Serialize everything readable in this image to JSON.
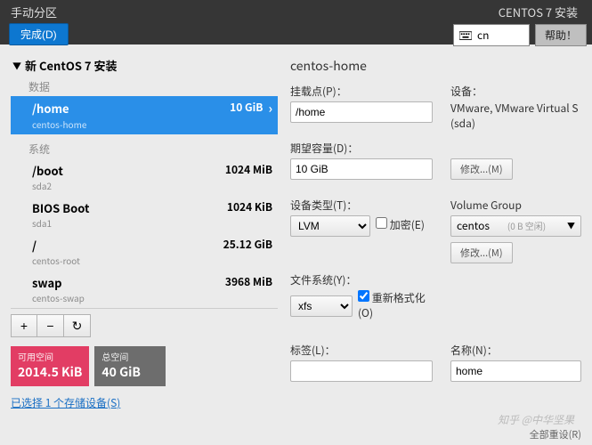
{
  "header": {
    "title": "手动分区",
    "done": "完成(D)",
    "install_title": "CENTOS 7 安装",
    "lang": "cn",
    "help": "帮助！"
  },
  "tree": {
    "title": "新 CentOS 7 安装",
    "data_label": "数据",
    "system_label": "系统",
    "items": [
      {
        "name": "/home",
        "sub": "centos-home",
        "size": "10 GiB",
        "selected": true,
        "section": "data"
      },
      {
        "name": "/boot",
        "sub": "sda2",
        "size": "1024 MiB",
        "section": "system"
      },
      {
        "name": "BIOS Boot",
        "sub": "sda1",
        "size": "1024 KiB",
        "section": "system"
      },
      {
        "name": "/",
        "sub": "centos-root",
        "size": "25.12 GiB",
        "section": "system"
      },
      {
        "name": "swap",
        "sub": "centos-swap",
        "size": "3968 MiB",
        "section": "system"
      }
    ]
  },
  "toolbar": {
    "add": "+",
    "remove": "−",
    "reload": "↻"
  },
  "space": {
    "avail_label": "可用空间",
    "avail_value": "2014.5 KiB",
    "total_label": "总空间",
    "total_value": "40 GiB"
  },
  "storage_link": "已选择 1 个存储设备(S)",
  "detail": {
    "title": "centos-home",
    "mount_label": "挂载点(P)：",
    "mount_value": "/home",
    "device_label": "设备：",
    "device_value": "VMware, VMware Virtual S (sda)",
    "capacity_label": "期望容量(D)：",
    "capacity_value": "10 GiB",
    "modify": "修改...(M)",
    "devtype_label": "设备类型(T)：",
    "devtype_value": "LVM",
    "encrypt_label": "加密(E)",
    "vg_label": "Volume Group",
    "vg_value": "centos",
    "vg_free": "(0 B 空闲)",
    "fs_label": "文件系统(Y)：",
    "fs_value": "xfs",
    "reformat_label": "重新格式化(O)",
    "tag_label": "标签(L)：",
    "tag_value": "",
    "name_label": "名称(N)：",
    "name_value": "home"
  },
  "reset_all": "全部重设(R)",
  "watermark": "知乎 @中华坚果"
}
